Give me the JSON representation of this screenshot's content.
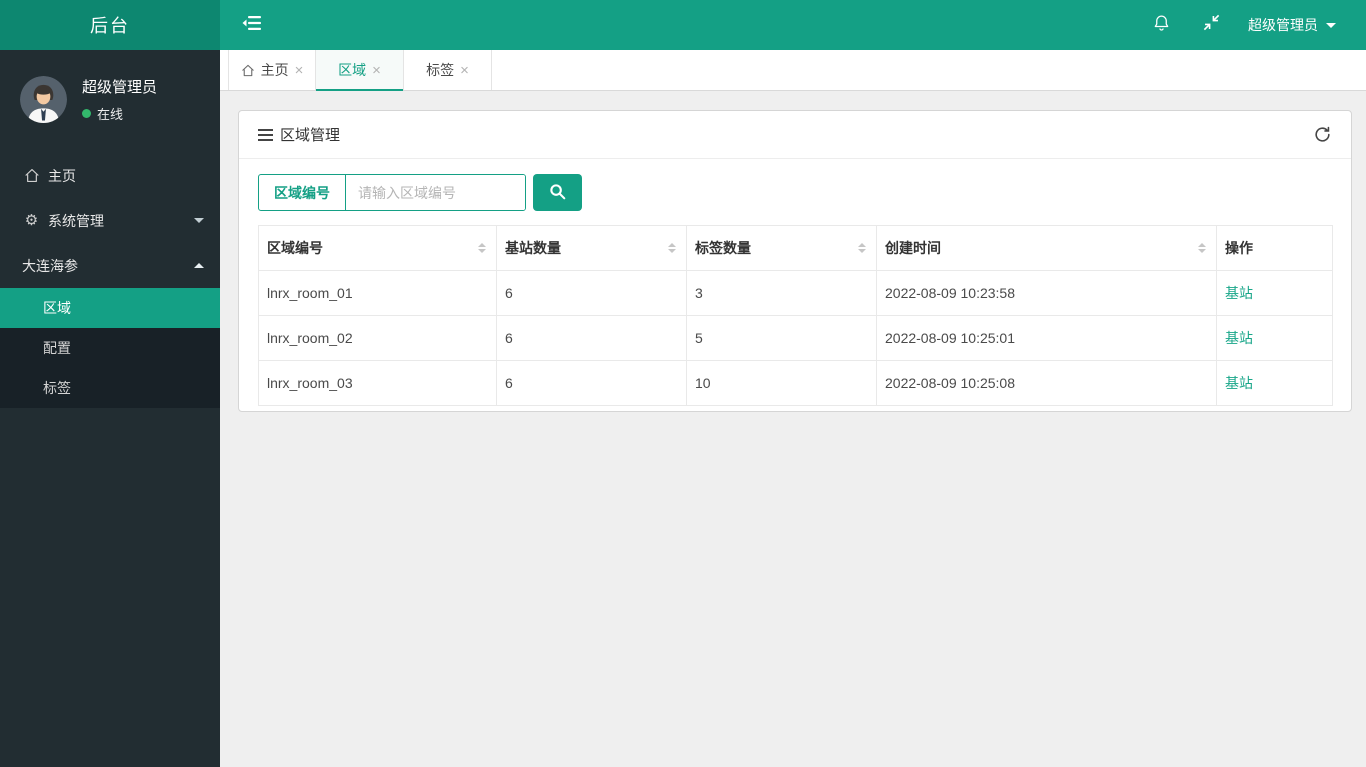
{
  "app": {
    "logo_text": "后台"
  },
  "navbar": {
    "user_label": "超级管理员"
  },
  "sidebar": {
    "user": {
      "name": "超级管理员",
      "status": "在线"
    },
    "menu": [
      {
        "label": "主页",
        "icon": "home-icon"
      },
      {
        "label": "系统管理",
        "icon": "gear-icon",
        "caret": "down"
      },
      {
        "label": "大连海参",
        "caret": "up"
      }
    ],
    "submenu": [
      {
        "label": "区域",
        "active": true
      },
      {
        "label": "配置",
        "active": false
      },
      {
        "label": "标签",
        "active": false
      }
    ]
  },
  "tabs": [
    {
      "label": "主页",
      "icon": "home-icon",
      "active": false
    },
    {
      "label": "区域",
      "active": true
    },
    {
      "label": "标签",
      "active": false
    }
  ],
  "panel": {
    "title": "区域管理",
    "search": {
      "label": "区域编号",
      "placeholder": "请输入区域编号"
    },
    "table": {
      "columns": [
        {
          "label": "区域编号",
          "sortable": true
        },
        {
          "label": "基站数量",
          "sortable": true
        },
        {
          "label": "标签数量",
          "sortable": true
        },
        {
          "label": "创建时间",
          "sortable": true
        },
        {
          "label": "操作",
          "sortable": false
        }
      ],
      "rows": [
        {
          "region": "lnrx_room_01",
          "stations": "6",
          "tags": "3",
          "created": "2022-08-09 10:23:58",
          "action": "基站"
        },
        {
          "region": "lnrx_room_02",
          "stations": "6",
          "tags": "5",
          "created": "2022-08-09 10:25:01",
          "action": "基站"
        },
        {
          "region": "lnrx_room_03",
          "stations": "6",
          "tags": "10",
          "created": "2022-08-09 10:25:08",
          "action": "基站"
        }
      ]
    }
  },
  "icons": {
    "close": "×",
    "gear": "⚙"
  },
  "colors": {
    "accent": "#14a085",
    "logo_bg": "#0d8770",
    "sidebar_bg": "#222d32",
    "submenu_bg": "#182127",
    "online_green": "#33b86c",
    "content_bg": "#efefef",
    "link": "#18a689"
  }
}
